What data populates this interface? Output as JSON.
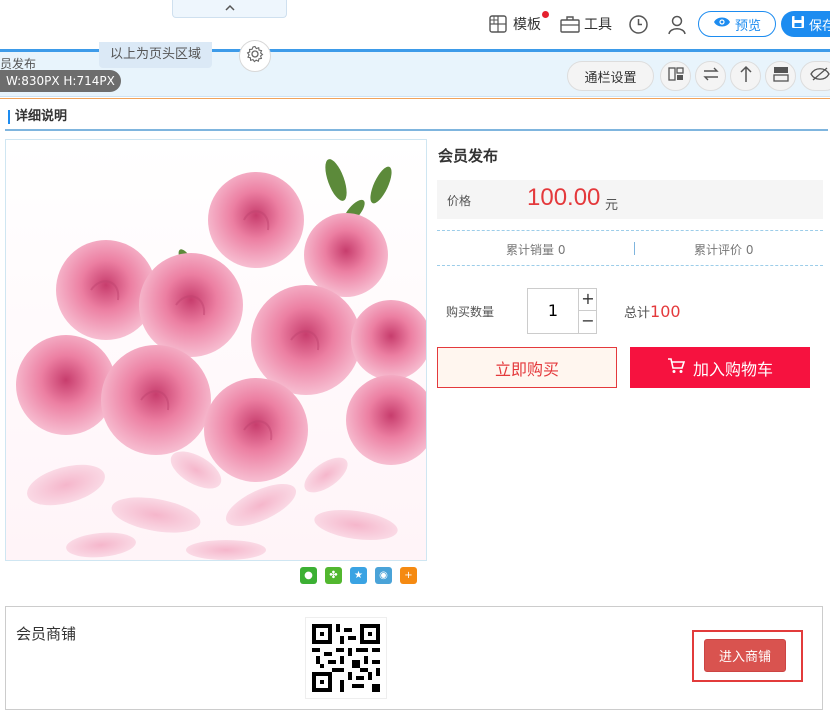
{
  "toolbar": {
    "collapse_icon": "chevron-up-icon",
    "template_label": "模板",
    "tools_label": "工具",
    "preview_label": "预览",
    "save_label": "保存"
  },
  "header_zone": {
    "label": "以上为页头区域",
    "cut_text": "员发布",
    "dimension": "W:830PX H:714PX",
    "column_settings": "通栏设置"
  },
  "section": {
    "title": "详细说明"
  },
  "product": {
    "title": "会员发布",
    "price_label": "价格",
    "price": "100.00",
    "price_unit": "元",
    "sales_label": "累计销量 0",
    "reviews_label": "累计评价 0",
    "qty_label": "购买数量",
    "qty_value": "1",
    "qty_plus": "+",
    "qty_minus": "−",
    "total_prefix": "总计",
    "total_value": "100",
    "buy_now": "立即购买",
    "add_to_cart": "加入购物车"
  },
  "shop": {
    "title": "会员商铺",
    "enter_button": "进入商铺"
  },
  "colors": {
    "accent_blue": "#1d8cf0",
    "price_red": "#e4393c",
    "cart_red": "#f6123f",
    "shop_button": "#d9534f"
  }
}
